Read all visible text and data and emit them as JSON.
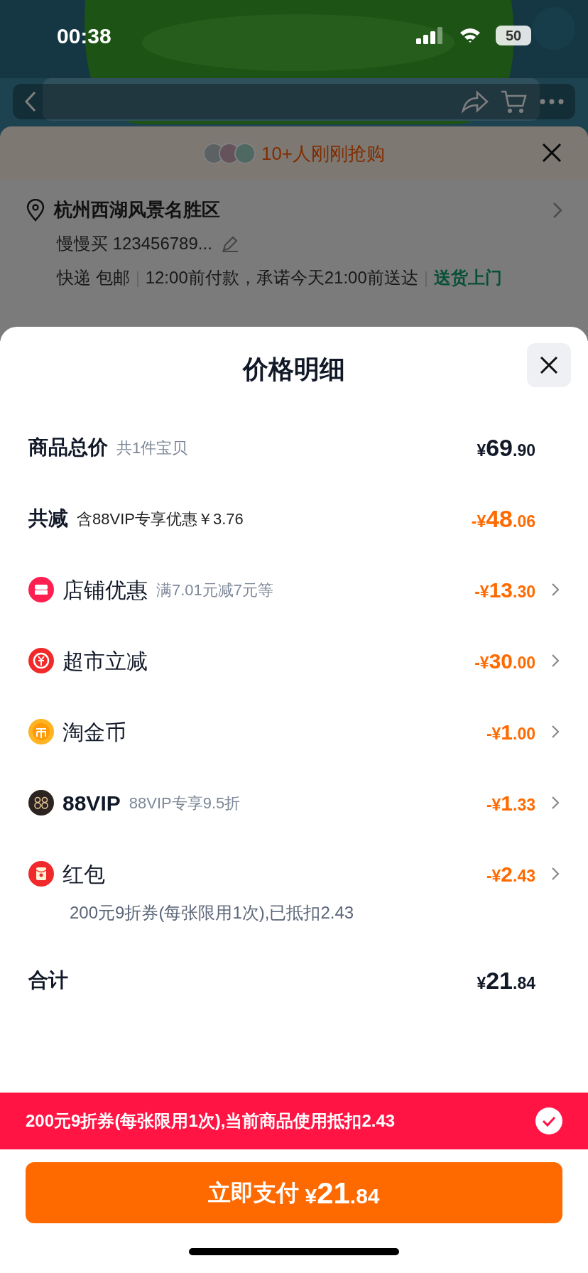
{
  "status_bar": {
    "time": "00:38",
    "battery": "50"
  },
  "order_sheet": {
    "buyers_note": "10+人刚刚抢购",
    "address": "杭州西湖风景名胜区",
    "recipient": "慢慢买 123456789...",
    "delivery": [
      {
        "kind": "plain",
        "text": "快递 包邮"
      },
      {
        "kind": "plain",
        "text": "12:00前付款，承诺今天21:00前送达"
      },
      {
        "kind": "highlight",
        "text": "送货上门"
      }
    ]
  },
  "price_detail": {
    "title": "价格明细",
    "rows": [
      {
        "kind": "total",
        "label": "商品总价",
        "note": "共1件宝贝",
        "amount": "¥69.90"
      },
      {
        "kind": "reduction",
        "label": "共减",
        "note": "含88VIP专享优惠￥3.76",
        "amount": "-¥48.06"
      },
      {
        "kind": "store",
        "label": "店铺优惠",
        "note": "满7.01元减7元等",
        "amount": "-¥13.30"
      },
      {
        "kind": "supermarket",
        "label": "超市立减",
        "amount": "-¥30.00"
      },
      {
        "kind": "coin",
        "label": "淘金币",
        "amount": "-¥1.00"
      },
      {
        "kind": "vip",
        "label": "88VIP",
        "note": "88VIP专享9.5折",
        "amount": "-¥1.33"
      },
      {
        "kind": "redpacket",
        "label": "红包",
        "detail": "200元9折券(每张限用1次),已抵扣2.43",
        "amount": "-¥2.43"
      },
      {
        "kind": "sum",
        "label": "合计",
        "amount": "¥21.84"
      }
    ]
  },
  "coupon_bar": {
    "text": "200元9折券(每张限用1次),当前商品使用抵扣2.43",
    "checked": true
  },
  "pay_button": {
    "label": "立即支付",
    "amount": "¥21.84"
  }
}
